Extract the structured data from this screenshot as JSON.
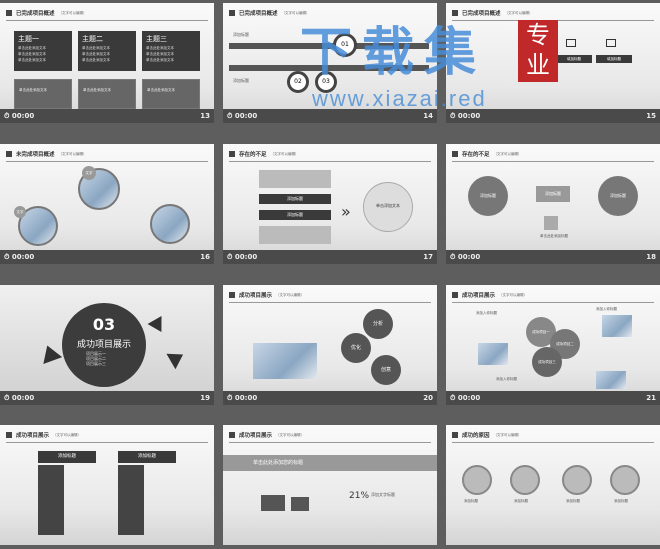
{
  "slide_time": "00:00",
  "slides": [
    {
      "num": "13",
      "title": "已完成项目概述",
      "subtitle": "（文字可以编辑）",
      "themes": [
        "主题一",
        "主题二",
        "主题三"
      ],
      "bullet": "单击此处添加文本",
      "box_text": "单击此处添加文本"
    },
    {
      "num": "14",
      "title": "已完成项目概述",
      "subtitle": "（文字可以编辑）",
      "labels": [
        "添加标题",
        "添加标题"
      ],
      "circles": [
        "01",
        "02",
        "03"
      ]
    },
    {
      "num": "15",
      "title": "已完成项目概述",
      "subtitle": "（文字可以编辑）",
      "labels": [
        "填加标题",
        "填加标题",
        "填加标题"
      ]
    },
    {
      "num": "16",
      "title": "未完成项目概述",
      "subtitle": "（文字可以编辑）",
      "labels": [
        "文字",
        "文字"
      ]
    },
    {
      "num": "17",
      "title": "存在的不足",
      "subtitle": "（文字可以编辑）",
      "labels": [
        "添加标题",
        "添加标题"
      ],
      "center": "单击添加文本"
    },
    {
      "num": "18",
      "title": "存在的不足",
      "subtitle": "（文字可以编辑）",
      "labels": [
        "添加标题",
        "添加标题",
        "添加标题"
      ],
      "bottom": "单击此处添加标题"
    },
    {
      "num": "19",
      "section_num": "03",
      "section_title": "成功项目展示",
      "items": [
        "项目展示一",
        "项目展示二",
        "项目展示三"
      ]
    },
    {
      "num": "20",
      "title": "成功项目展示",
      "subtitle": "（文字可以编辑）",
      "gears": [
        "分析",
        "优化",
        "创意"
      ]
    },
    {
      "num": "21",
      "title": "成功项目展示",
      "subtitle": "（文字可以编辑）",
      "labels": [
        "添加入你标题",
        "成功项目一",
        "成功项目二",
        "成功项目三",
        "添加入你标题",
        "添加入你标题"
      ]
    },
    {
      "num": "22",
      "title": "成功项目展示",
      "subtitle": "（文字可以编辑）",
      "labels": [
        "添加标题",
        "添加标题"
      ]
    },
    {
      "num": "23",
      "title": "成功项目展示",
      "subtitle": "（文字可以编辑）",
      "headline": "单击此处添加您的标题",
      "percent": "21%",
      "pct_label": "添加文字标题"
    },
    {
      "num": "24",
      "title": "成功的原因",
      "subtitle": "（文字可以编辑）",
      "labels": [
        "添加标题",
        "添加标题",
        "添加标题",
        "添加标题"
      ]
    }
  ],
  "watermark": {
    "big": "下载集",
    "url": "www.xiazai.red",
    "seal": "专业"
  }
}
